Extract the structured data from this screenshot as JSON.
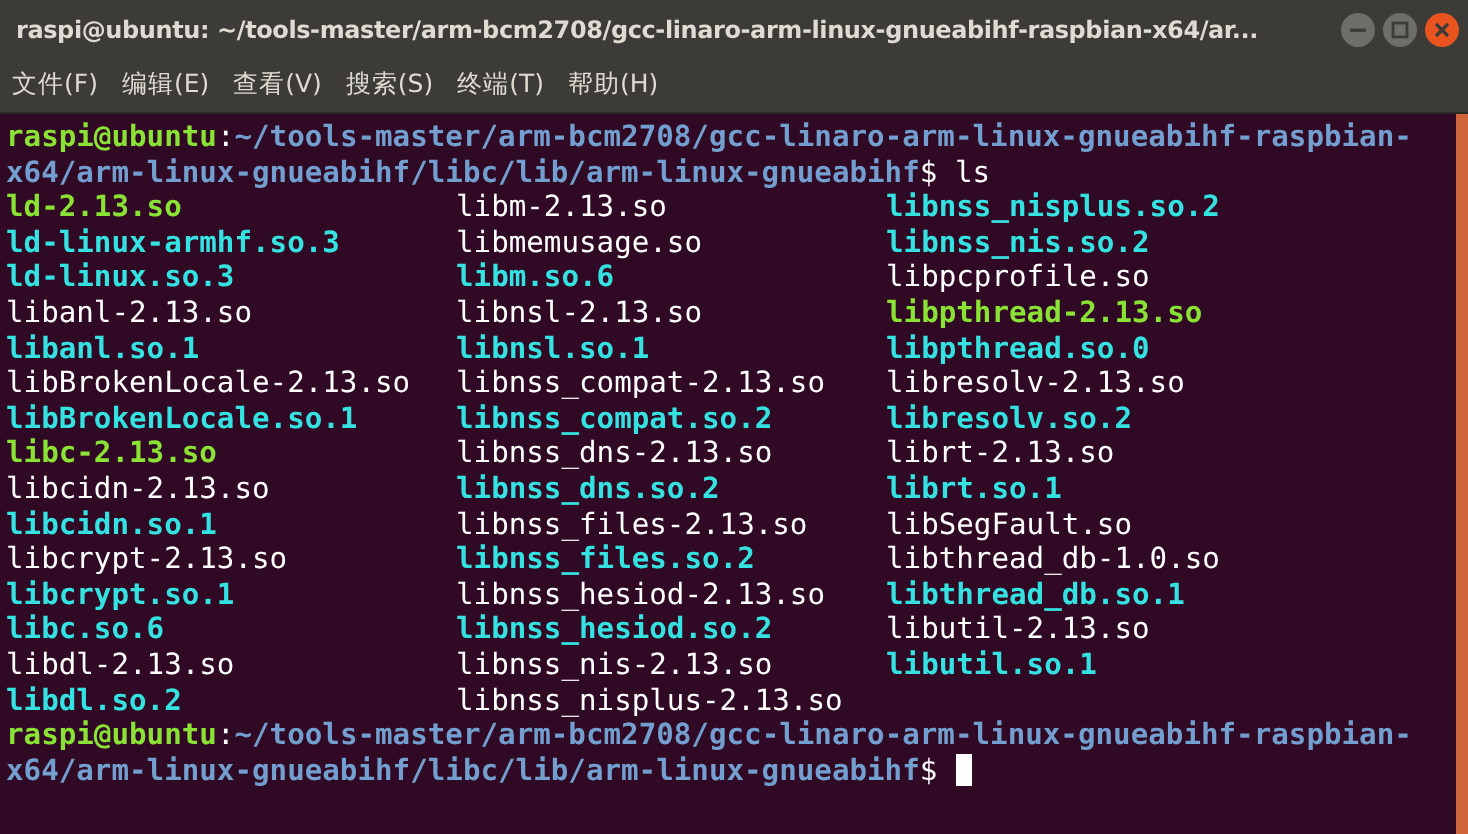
{
  "window": {
    "title": "raspi@ubuntu: ~/tools-master/arm-bcm2708/gcc-linaro-arm-linux-gnueabihf-raspbian-x64/ar..."
  },
  "menu": [
    "文件(F)",
    "编辑(E)",
    "查看(V)",
    "搜索(S)",
    "终端(T)",
    "帮助(H)"
  ],
  "prompt_before": [
    [
      {
        "kind": "user",
        "text": "raspi@ubuntu"
      },
      {
        "kind": "plain",
        "text": ":"
      },
      {
        "kind": "path",
        "text": "~/tools-master/arm-bcm2708/gcc-linaro-arm-linux-gnueabihf-raspbian-"
      }
    ],
    [
      {
        "kind": "path",
        "text": "x64/arm-linux-gnueabihf/libc/lib/arm-linux-gnueabihf"
      },
      {
        "kind": "plain",
        "text": "$ ls"
      }
    ]
  ],
  "listing": [
    [
      {
        "kind": "exec",
        "text": "ld-2.13.so"
      },
      {
        "kind": "link",
        "text": "ld-linux-armhf.so.3"
      },
      {
        "kind": "link",
        "text": "ld-linux.so.3"
      },
      {
        "kind": "plain",
        "text": "libanl-2.13.so"
      },
      {
        "kind": "link",
        "text": "libanl.so.1"
      },
      {
        "kind": "plain",
        "text": "libBrokenLocale-2.13.so"
      },
      {
        "kind": "link",
        "text": "libBrokenLocale.so.1"
      },
      {
        "kind": "exec",
        "text": "libc-2.13.so"
      },
      {
        "kind": "plain",
        "text": "libcidn-2.13.so"
      },
      {
        "kind": "link",
        "text": "libcidn.so.1"
      },
      {
        "kind": "plain",
        "text": "libcrypt-2.13.so"
      },
      {
        "kind": "link",
        "text": "libcrypt.so.1"
      },
      {
        "kind": "link",
        "text": "libc.so.6"
      },
      {
        "kind": "plain",
        "text": "libdl-2.13.so"
      },
      {
        "kind": "link",
        "text": "libdl.so.2"
      }
    ],
    [
      {
        "kind": "plain",
        "text": "libm-2.13.so"
      },
      {
        "kind": "plain",
        "text": "libmemusage.so"
      },
      {
        "kind": "link",
        "text": "libm.so.6"
      },
      {
        "kind": "plain",
        "text": "libnsl-2.13.so"
      },
      {
        "kind": "link",
        "text": "libnsl.so.1"
      },
      {
        "kind": "plain",
        "text": "libnss_compat-2.13.so"
      },
      {
        "kind": "link",
        "text": "libnss_compat.so.2"
      },
      {
        "kind": "plain",
        "text": "libnss_dns-2.13.so"
      },
      {
        "kind": "link",
        "text": "libnss_dns.so.2"
      },
      {
        "kind": "plain",
        "text": "libnss_files-2.13.so"
      },
      {
        "kind": "link",
        "text": "libnss_files.so.2"
      },
      {
        "kind": "plain",
        "text": "libnss_hesiod-2.13.so"
      },
      {
        "kind": "link",
        "text": "libnss_hesiod.so.2"
      },
      {
        "kind": "plain",
        "text": "libnss_nis-2.13.so"
      },
      {
        "kind": "plain",
        "text": "libnss_nisplus-2.13.so"
      }
    ],
    [
      {
        "kind": "link",
        "text": "libnss_nisplus.so.2"
      },
      {
        "kind": "link",
        "text": "libnss_nis.so.2"
      },
      {
        "kind": "plain",
        "text": "libpcprofile.so"
      },
      {
        "kind": "exec",
        "text": "libpthread-2.13.so"
      },
      {
        "kind": "link",
        "text": "libpthread.so.0"
      },
      {
        "kind": "plain",
        "text": "libresolv-2.13.so"
      },
      {
        "kind": "link",
        "text": "libresolv.so.2"
      },
      {
        "kind": "plain",
        "text": "librt-2.13.so"
      },
      {
        "kind": "link",
        "text": "librt.so.1"
      },
      {
        "kind": "plain",
        "text": "libSegFault.so"
      },
      {
        "kind": "plain",
        "text": "libthread_db-1.0.so"
      },
      {
        "kind": "link",
        "text": "libthread_db.so.1"
      },
      {
        "kind": "plain",
        "text": "libutil-2.13.so"
      },
      {
        "kind": "link",
        "text": "libutil.so.1"
      }
    ]
  ],
  "prompt_after": [
    [
      {
        "kind": "user",
        "text": "raspi@ubuntu"
      },
      {
        "kind": "plain",
        "text": ":"
      },
      {
        "kind": "path",
        "text": "~/tools-master/arm-bcm2708/gcc-linaro-arm-linux-gnueabihf-raspbian-"
      }
    ],
    [
      {
        "kind": "path",
        "text": "x64/arm-linux-gnueabihf/libc/lib/arm-linux-gnueabihf"
      },
      {
        "kind": "plain",
        "text": "$"
      }
    ]
  ]
}
